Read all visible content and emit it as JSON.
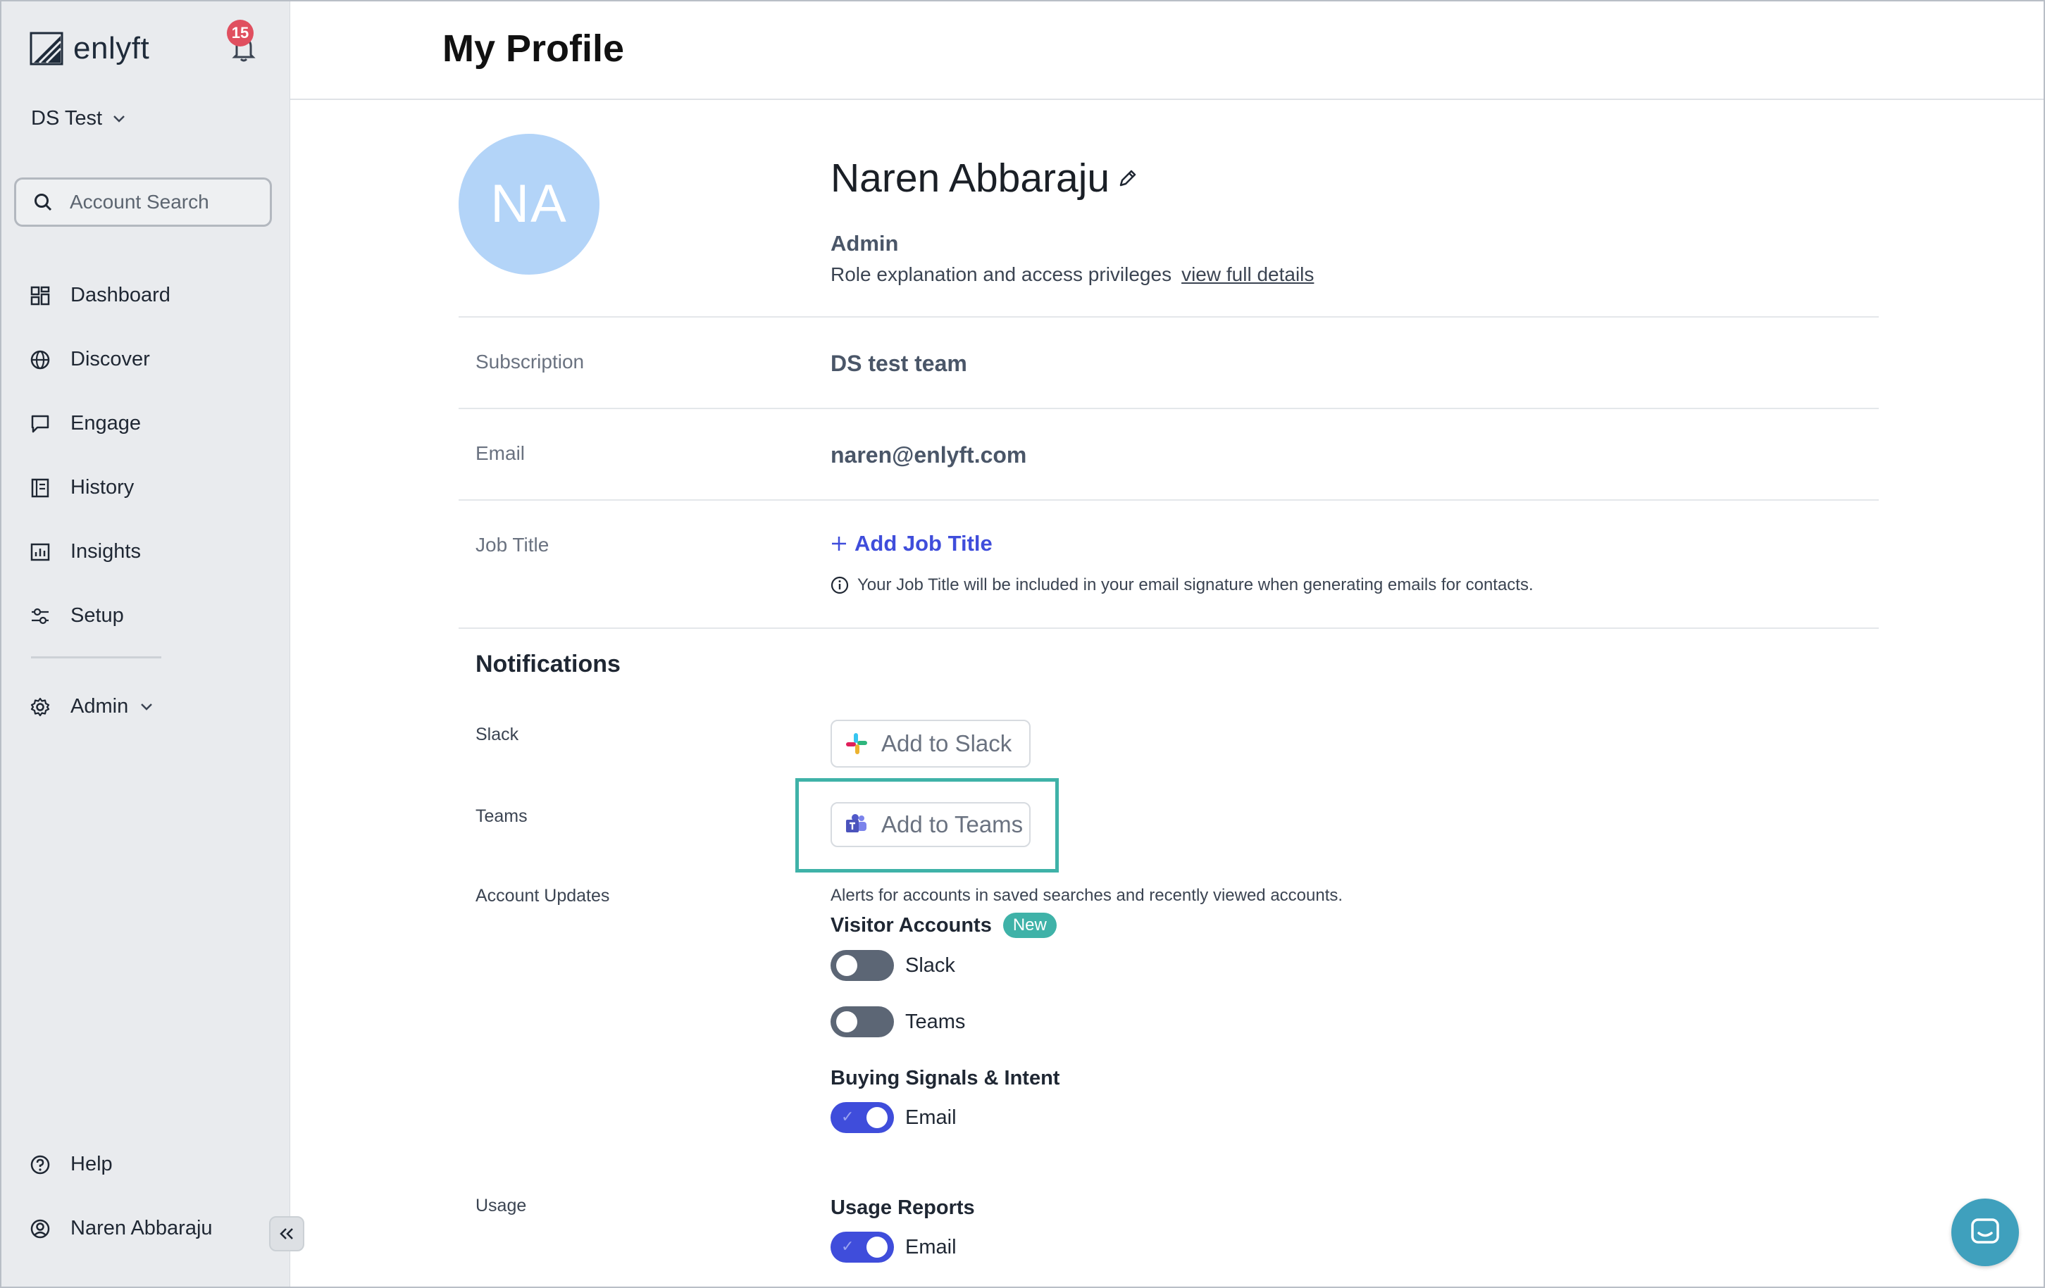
{
  "app": {
    "logo_text": "enlyft",
    "notification_count": "15"
  },
  "workspace": {
    "name": "DS Test"
  },
  "search": {
    "placeholder": "Account Search"
  },
  "nav": {
    "items": [
      {
        "label": "Dashboard",
        "icon": "dashboard-icon"
      },
      {
        "label": "Discover",
        "icon": "globe-icon"
      },
      {
        "label": "Engage",
        "icon": "chat-icon"
      },
      {
        "label": "History",
        "icon": "history-icon"
      },
      {
        "label": "Insights",
        "icon": "insights-icon"
      },
      {
        "label": "Setup",
        "icon": "sliders-icon"
      }
    ],
    "admin": "Admin",
    "help": "Help",
    "user": "Naren Abbaraju"
  },
  "page": {
    "title": "My Profile"
  },
  "profile": {
    "initials": "NA",
    "name": "Naren Abbaraju",
    "role": "Admin",
    "role_desc": "Role explanation and access privileges",
    "role_link": "view full details",
    "subscription_label": "Subscription",
    "subscription_value": "DS test team",
    "email_label": "Email",
    "email_value": "naren@enlyft.com",
    "job_title_label": "Job Title",
    "add_job_title": "Add Job Title",
    "job_title_note": "Your Job Title will be included in your email signature when generating emails for contacts."
  },
  "notifications": {
    "title": "Notifications",
    "slack_label": "Slack",
    "slack_button": "Add to Slack",
    "teams_label": "Teams",
    "teams_button": "Add to Teams",
    "account_updates_label": "Account Updates",
    "account_updates_desc": "Alerts for accounts in saved searches and recently viewed accounts.",
    "visitor_accounts": "Visitor Accounts",
    "new_badge": "New",
    "visitor_slack": "Slack",
    "visitor_teams": "Teams",
    "buying_signals": "Buying Signals & Intent",
    "buying_email": "Email",
    "usage_label": "Usage",
    "usage_reports": "Usage Reports",
    "usage_email": "Email"
  },
  "colors": {
    "accent": "#3f4ddb",
    "teal": "#3fb2a8",
    "avatar": "#b3d4f8",
    "sidebar": "#e9ebee"
  }
}
